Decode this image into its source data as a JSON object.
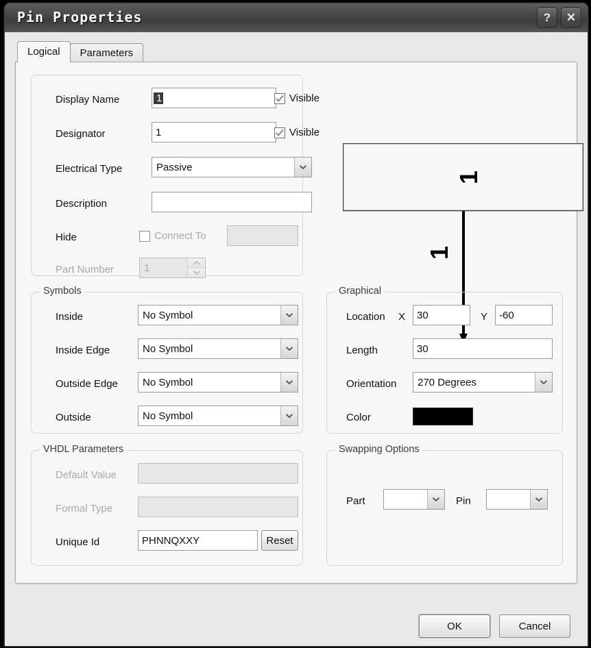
{
  "window": {
    "title": "Pin Properties",
    "help_button": "?",
    "close_button": "✕"
  },
  "tabs": [
    {
      "label": "Logical",
      "active": true
    },
    {
      "label": "Parameters",
      "active": false
    }
  ],
  "logical": {
    "display_name": {
      "label": "Display Name",
      "value": "1",
      "visible_label": "Visible",
      "visible_checked": true
    },
    "designator": {
      "label": "Designator",
      "value": "1",
      "visible_label": "Visible",
      "visible_checked": true
    },
    "electrical_type": {
      "label": "Electrical Type",
      "value": "Passive"
    },
    "description": {
      "label": "Description",
      "value": ""
    },
    "hide": {
      "label": "Hide",
      "checked": false,
      "connect_to_label": "Connect To",
      "connect_to_value": "",
      "enabled": false
    },
    "part_number": {
      "label": "Part Number",
      "value": "1",
      "enabled": false
    }
  },
  "symbols": {
    "title": "Symbols",
    "rows": [
      {
        "label": "Inside",
        "value": "No Symbol"
      },
      {
        "label": "Inside Edge",
        "value": "No Symbol"
      },
      {
        "label": "Outside Edge",
        "value": "No Symbol"
      },
      {
        "label": "Outside",
        "value": "No Symbol"
      }
    ]
  },
  "vhdl": {
    "title": "VHDL Parameters",
    "default_value": {
      "label": "Default Value",
      "value": "",
      "enabled": false
    },
    "formal_type": {
      "label": "Formal Type",
      "value": "",
      "enabled": false
    },
    "unique_id": {
      "label": "Unique Id",
      "value": "PHNNQXXY"
    },
    "reset_button": "Reset"
  },
  "graphical": {
    "title": "Graphical",
    "location_label": "Location",
    "x_label": "X",
    "x_value": "30",
    "y_label": "Y",
    "y_value": "-60",
    "length_label": "Length",
    "length_value": "30",
    "orientation_label": "Orientation",
    "orientation_value": "270 Degrees",
    "color_label": "Color",
    "color_value": "#000000"
  },
  "swapping": {
    "title": "Swapping Options",
    "part_label": "Part",
    "part_value": "",
    "pin_label": "Pin",
    "pin_value": ""
  },
  "preview": {
    "pin_designator": "1",
    "pin_name": "1",
    "line_color": "#000000",
    "body_border_color": "#444444"
  },
  "footer": {
    "ok": "OK",
    "cancel": "Cancel"
  }
}
